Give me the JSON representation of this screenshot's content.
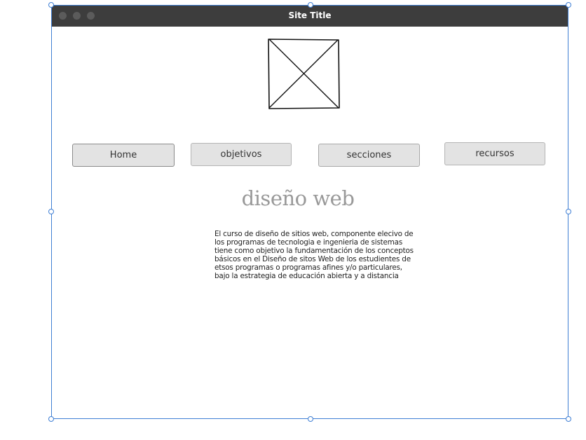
{
  "window": {
    "title": "Site Title"
  },
  "nav": {
    "items": [
      {
        "label": "Home"
      },
      {
        "label": "objetivos"
      },
      {
        "label": "secciones"
      },
      {
        "label": "recursos"
      }
    ]
  },
  "content": {
    "heading": "diseño web",
    "paragraph": "El curso de diseño de sitios web, componente elecivo de los programas de tecnologia e ingenieria de sistemas tiene como objetivo la fundamentación de los conceptos básicos en el Diseño de sitos Web de los estudientes de etsos programas o programas afines y/o particulares, bajo la estrategia de educación abierta y a distancia"
  },
  "colors": {
    "titlebar": "#3d3d3d",
    "button_bg": "#e3e3e3",
    "heading": "#999999",
    "selection": "#3f7fd4"
  },
  "icons": {
    "placeholder": "image-placeholder-icon",
    "window_controls": "window-dot-icon",
    "handles": "selection-handle-icon"
  }
}
